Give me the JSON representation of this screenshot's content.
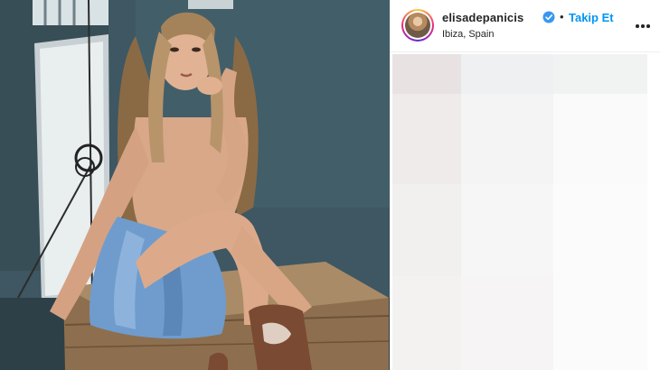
{
  "post": {
    "username": "elisadepanicis",
    "verified": true,
    "separator": "•",
    "follow_label": "Takip Et",
    "location": "Ibiza, Spain"
  },
  "photo": {
    "description_icon": "post-photo"
  },
  "colors": {
    "follow_blue": "#0095f6",
    "text": "#262626",
    "verified_blue": "#3897f0"
  }
}
